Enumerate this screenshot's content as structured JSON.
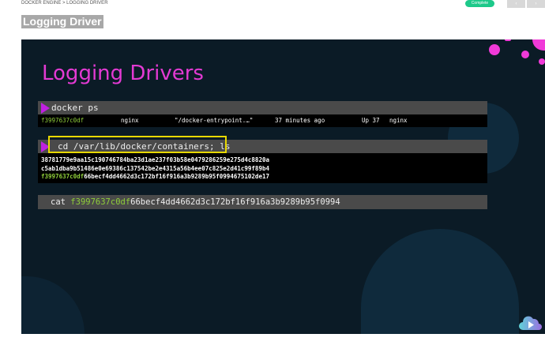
{
  "breadcrumb": "DOCKER ENGINE > LOGGING DRIVER",
  "status": "Complete",
  "nav": {
    "prev": "‹",
    "next": "›"
  },
  "page_title": "Logging Driver",
  "slide": {
    "title": "Logging Drivers",
    "cmd1": "docker ps",
    "ps_row": {
      "id": "f3997637c0df",
      "image": "nginx",
      "command": "\"/docker-entrypoint.…\"",
      "created": "37 minutes ago",
      "status": "Up 37",
      "name": "nginx"
    },
    "cmd2": "cd /var/lib/docker/containers; ls",
    "ls": [
      "38781779e9aa15c190746784ba23d1ae237f03b58e0479286259e275d4c8820a",
      "c5ab1dba9b51486e0e69386c137542be2e4315a56b4ee07c825e2d41c99f89b4"
    ],
    "ls3_prefix": "f3997637c0df",
    "ls3_rest": "66becf4dd4662d3c172bf16f916a3b9289b95f0994675102de17",
    "cmd3_cmd": "cat",
    "cmd3_prefix": "f3997637c0df",
    "cmd3_rest": "66becf4dd4662d3c172bf16f916a3b9289b95f0994"
  },
  "colors": {
    "accent": "#e33ad3",
    "highlight": "#8fce3a",
    "box": "#e8d800",
    "badge": "#1dc98a"
  }
}
